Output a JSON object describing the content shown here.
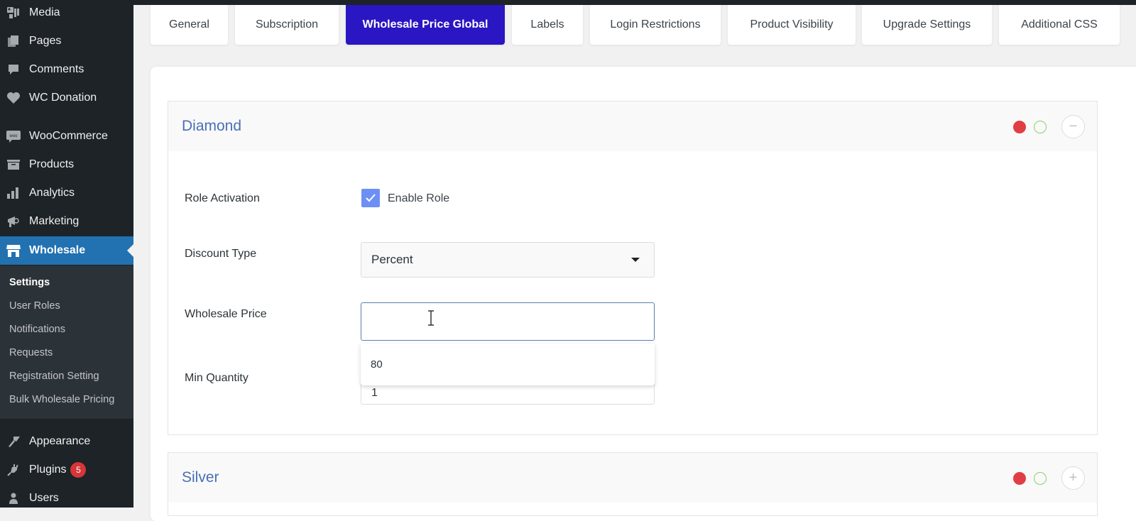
{
  "sidebar": {
    "items": [
      {
        "label": "Media",
        "icon": "media-icon"
      },
      {
        "label": "Pages",
        "icon": "pages-icon"
      },
      {
        "label": "Comments",
        "icon": "comments-icon"
      },
      {
        "label": "WC Donation",
        "icon": "heart-icon"
      },
      {
        "label": "WooCommerce",
        "icon": "woocommerce-icon"
      },
      {
        "label": "Products",
        "icon": "products-icon"
      },
      {
        "label": "Analytics",
        "icon": "analytics-icon"
      },
      {
        "label": "Marketing",
        "icon": "megaphone-icon"
      },
      {
        "label": "Wholesale",
        "icon": "store-icon",
        "active": true
      }
    ],
    "submenu": [
      {
        "label": "Settings",
        "current": true
      },
      {
        "label": "User Roles"
      },
      {
        "label": "Notifications"
      },
      {
        "label": "Requests"
      },
      {
        "label": "Registration Setting"
      },
      {
        "label": "Bulk Wholesale Pricing"
      }
    ],
    "items_after": [
      {
        "label": "Appearance",
        "icon": "paintbrush-icon"
      },
      {
        "label": "Plugins",
        "icon": "plugin-icon",
        "badge": "5"
      },
      {
        "label": "Users",
        "icon": "user-icon"
      }
    ]
  },
  "tabs": [
    {
      "label": "General"
    },
    {
      "label": "Subscription"
    },
    {
      "label": "Wholesale Price Global",
      "active": true
    },
    {
      "label": "Labels"
    },
    {
      "label": "Login Restrictions"
    },
    {
      "label": "Product Visibility"
    },
    {
      "label": "Upgrade Settings"
    },
    {
      "label": "Additional CSS"
    }
  ],
  "roles": [
    {
      "name": "Diamond",
      "expanded": true,
      "toggle_symbol": "−",
      "fields": {
        "role_activation_label": "Role Activation",
        "enable_role_label": "Enable Role",
        "enable_role_checked": true,
        "discount_type_label": "Discount Type",
        "discount_type_value": "Percent",
        "wholesale_price_label": "Wholesale Price",
        "wholesale_price_value": "",
        "wholesale_price_suggestion": "80",
        "min_quantity_label": "Min Quantity",
        "min_quantity_value": "1"
      }
    },
    {
      "name": "Silver",
      "expanded": false,
      "toggle_symbol": "+"
    }
  ],
  "colors": {
    "sidebar_bg": "#1d2327",
    "sidebar_active": "#2271b1",
    "tab_active": "#2a16c2",
    "role_title": "#4a6fb5",
    "status_red": "#e03e44",
    "status_green": "#8ccf6a",
    "checkbox": "#6d8ff5"
  }
}
